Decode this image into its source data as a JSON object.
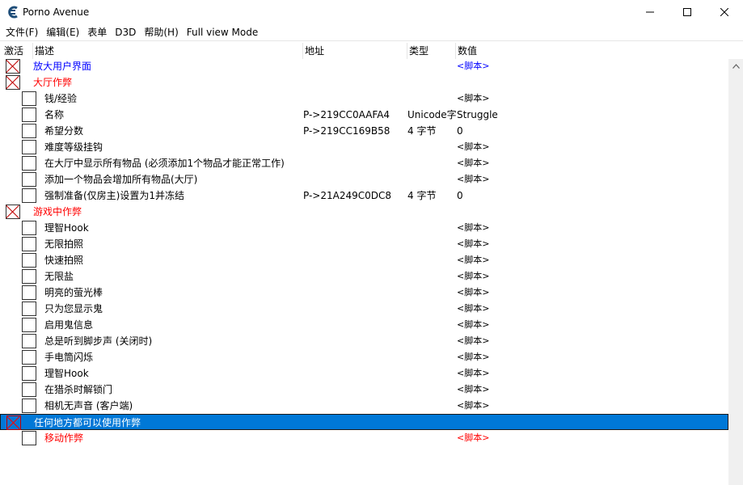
{
  "window": {
    "title": "Porno Avenue",
    "icon": "cheat-engine-icon",
    "controls": [
      "minimize-icon",
      "maximize-icon",
      "close-icon"
    ]
  },
  "menu": [
    "文件(F)",
    "编辑(E)",
    "表单",
    "D3D",
    "帮助(H)",
    "Full view Mode"
  ],
  "columns": {
    "active": "激活",
    "description": "描述",
    "address": "地址",
    "type": "类型",
    "value": "数值"
  },
  "colors": {
    "group_blue": "#0000ff",
    "group_red": "#ff0000",
    "selection": "#0078d7"
  },
  "rows": [
    {
      "description": "放大用户界面",
      "address": "",
      "type": "",
      "value": "<脚本>",
      "checked": true,
      "indent": 0,
      "color": "blue",
      "value_color": "blue",
      "selected": false
    },
    {
      "description": "大厅作弊",
      "address": "",
      "type": "",
      "value": "",
      "checked": true,
      "indent": 0,
      "color": "red",
      "value_color": "",
      "selected": false
    },
    {
      "description": "钱/经验",
      "address": "",
      "type": "",
      "value": "<脚本>",
      "checked": false,
      "indent": 1,
      "color": "",
      "value_color": "",
      "selected": false
    },
    {
      "description": "名称",
      "address": "P->219CC0AAFA4",
      "type": "Unicode字",
      "value": "Struggle",
      "checked": false,
      "indent": 1,
      "color": "",
      "value_color": "",
      "selected": false
    },
    {
      "description": "希望分数",
      "address": "P->219CC169B58",
      "type": "4 字节",
      "value": "0",
      "checked": false,
      "indent": 1,
      "color": "",
      "value_color": "",
      "selected": false
    },
    {
      "description": "难度等级挂钩",
      "address": "",
      "type": "",
      "value": "<脚本>",
      "checked": false,
      "indent": 1,
      "color": "",
      "value_color": "",
      "selected": false
    },
    {
      "description": "在大厅中显示所有物品 (必须添加1个物品才能正常工作)",
      "address": "",
      "type": "",
      "value": "<脚本>",
      "checked": false,
      "indent": 1,
      "color": "",
      "value_color": "",
      "selected": false
    },
    {
      "description": "添加一个物品会增加所有物品(大厅)",
      "address": "",
      "type": "",
      "value": "<脚本>",
      "checked": false,
      "indent": 1,
      "color": "",
      "value_color": "",
      "selected": false
    },
    {
      "description": "强制准备(仅房主)设置为1并冻结",
      "address": "P->21A249C0DC8",
      "type": "4 字节",
      "value": "0",
      "checked": false,
      "indent": 1,
      "color": "",
      "value_color": "",
      "selected": false
    },
    {
      "description": "游戏中作弊",
      "address": "",
      "type": "",
      "value": "",
      "checked": true,
      "indent": 0,
      "color": "red",
      "value_color": "",
      "selected": false
    },
    {
      "description": "理智Hook",
      "address": "",
      "type": "",
      "value": "<脚本>",
      "checked": false,
      "indent": 1,
      "color": "",
      "value_color": "",
      "selected": false
    },
    {
      "description": "无限拍照",
      "address": "",
      "type": "",
      "value": "<脚本>",
      "checked": false,
      "indent": 1,
      "color": "",
      "value_color": "",
      "selected": false
    },
    {
      "description": "快速拍照",
      "address": "",
      "type": "",
      "value": "<脚本>",
      "checked": false,
      "indent": 1,
      "color": "",
      "value_color": "",
      "selected": false
    },
    {
      "description": "无限盐",
      "address": "",
      "type": "",
      "value": "<脚本>",
      "checked": false,
      "indent": 1,
      "color": "",
      "value_color": "",
      "selected": false
    },
    {
      "description": "明亮的萤光棒",
      "address": "",
      "type": "",
      "value": "<脚本>",
      "checked": false,
      "indent": 1,
      "color": "",
      "value_color": "",
      "selected": false
    },
    {
      "description": "只为您显示鬼",
      "address": "",
      "type": "",
      "value": "<脚本>",
      "checked": false,
      "indent": 1,
      "color": "",
      "value_color": "",
      "selected": false
    },
    {
      "description": "启用鬼信息",
      "address": "",
      "type": "",
      "value": "<脚本>",
      "checked": false,
      "indent": 1,
      "color": "",
      "value_color": "",
      "selected": false
    },
    {
      "description": "总是听到脚步声 (关闭时)",
      "address": "",
      "type": "",
      "value": "<脚本>",
      "checked": false,
      "indent": 1,
      "color": "",
      "value_color": "",
      "selected": false
    },
    {
      "description": "手电筒闪烁",
      "address": "",
      "type": "",
      "value": "<脚本>",
      "checked": false,
      "indent": 1,
      "color": "",
      "value_color": "",
      "selected": false
    },
    {
      "description": "理智Hook",
      "address": "",
      "type": "",
      "value": "<脚本>",
      "checked": false,
      "indent": 1,
      "color": "",
      "value_color": "",
      "selected": false
    },
    {
      "description": "在猎杀时解锁门",
      "address": "",
      "type": "",
      "value": "<脚本>",
      "checked": false,
      "indent": 1,
      "color": "",
      "value_color": "",
      "selected": false
    },
    {
      "description": "相机无声音 (客户端)",
      "address": "",
      "type": "",
      "value": "<脚本>",
      "checked": false,
      "indent": 1,
      "color": "",
      "value_color": "",
      "selected": false
    },
    {
      "description": "任何地方都可以使用作弊",
      "address": "",
      "type": "",
      "value": "",
      "checked": true,
      "indent": 0,
      "color": "",
      "value_color": "",
      "selected": true
    },
    {
      "description": "移动作弊",
      "address": "",
      "type": "",
      "value": "<脚本>",
      "checked": false,
      "indent": 1,
      "color": "red",
      "value_color": "red",
      "selected": false
    }
  ]
}
